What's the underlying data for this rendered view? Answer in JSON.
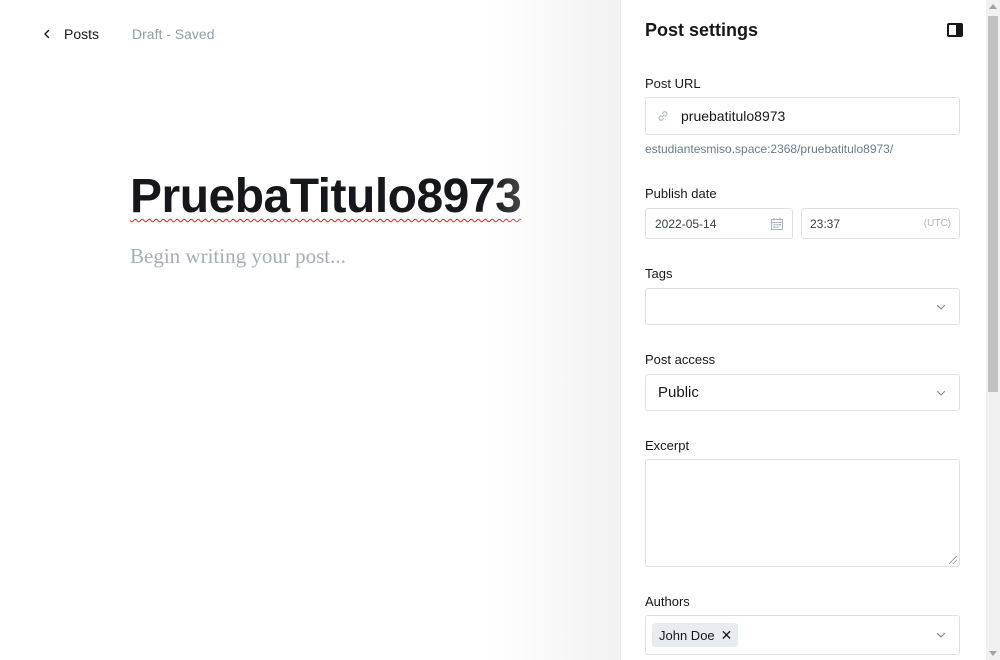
{
  "nav": {
    "back_label": "Posts",
    "status": "Draft - Saved"
  },
  "editor": {
    "title": "PruebaTitulo8973",
    "body_placeholder": "Begin writing your post..."
  },
  "settings": {
    "title": "Post settings",
    "post_url": {
      "label": "Post URL",
      "value": "pruebatitulo8973",
      "full_url": "estudiantesmiso.space:2368/pruebatitulo8973/"
    },
    "publish_date": {
      "label": "Publish date",
      "date": "2022-05-14",
      "time": "23:37",
      "timezone": "(UTC)"
    },
    "tags": {
      "label": "Tags",
      "value": ""
    },
    "post_access": {
      "label": "Post access",
      "value": "Public"
    },
    "excerpt": {
      "label": "Excerpt",
      "value": ""
    },
    "authors": {
      "label": "Authors",
      "items": [
        "John Doe"
      ]
    }
  },
  "icons": {
    "back": "chevron-left-icon",
    "panel_toggle": "sidebar-toggle-icon",
    "url": "link-icon",
    "date": "calendar-icon",
    "select": "chevron-down-icon",
    "remove": "close-icon"
  },
  "colors": {
    "text": "#15171a",
    "muted": "#8e9cac",
    "placeholder": "#a5adb8",
    "border": "#dde1e5",
    "chip_bg": "#e9ecef"
  }
}
